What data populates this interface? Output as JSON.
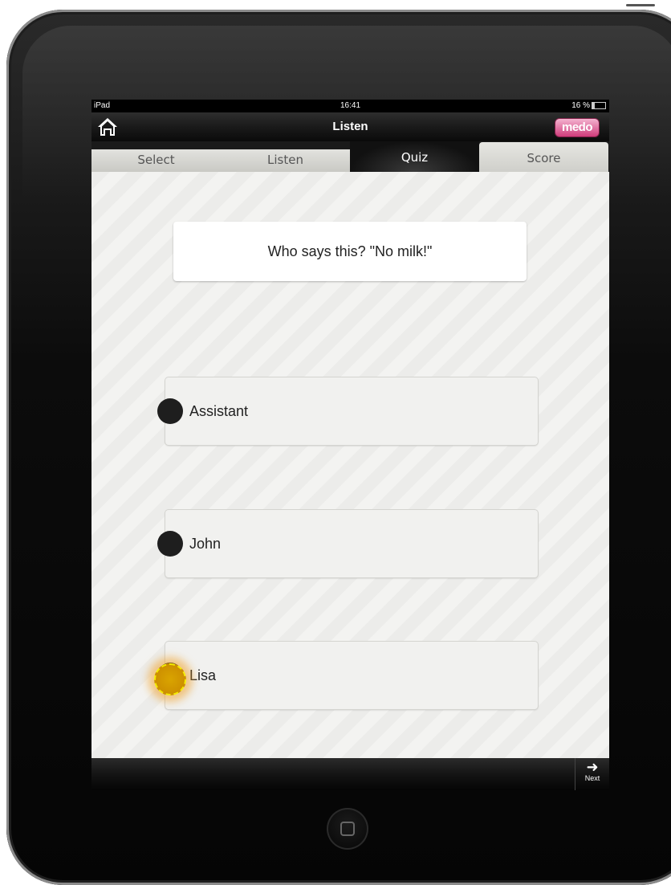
{
  "status_bar": {
    "carrier": "iPad",
    "time": "16:41",
    "battery": "16 %"
  },
  "nav_bar": {
    "title": "Listen",
    "logo_text": "medo"
  },
  "tabs": [
    {
      "label": "Select"
    },
    {
      "label": "Listen"
    },
    {
      "label": "Quiz"
    },
    {
      "label": "Score"
    }
  ],
  "active_tab": "Quiz",
  "question": "Who says this? \"No milk!\"",
  "answers": [
    {
      "label": "Assistant"
    },
    {
      "label": "John"
    },
    {
      "label": "Lisa"
    }
  ],
  "bottom_bar": {
    "next_label": "Next"
  },
  "colors": {
    "accent": "#cf3c7b",
    "touch_indicator": "#d9a400",
    "radio": "#1e1e1e"
  }
}
